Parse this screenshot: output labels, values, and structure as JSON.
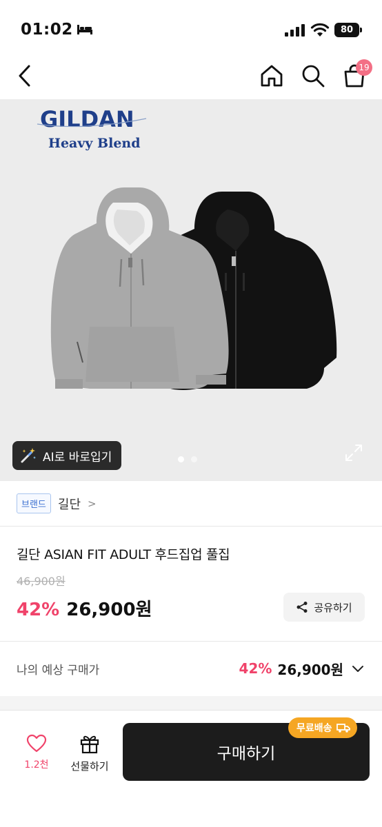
{
  "status_bar": {
    "time": "01:02",
    "battery": "80"
  },
  "nav": {
    "cart_count": "19"
  },
  "hero": {
    "logo_brand": "GILDAN",
    "logo_sub": "Heavy Blend",
    "ai_button_label": "AI로 바로입기",
    "slide_count": 2,
    "active_slide": 1
  },
  "brand": {
    "tag": "브랜드",
    "name": "길단",
    "chevron": ">"
  },
  "product": {
    "title": "길단 ASIAN FIT ADULT 후드집업 풀집",
    "original_price": "46,900원",
    "discount": "42%",
    "price": "26,900원",
    "share_label": "공유하기"
  },
  "expected": {
    "label": "나의 예상 구매가",
    "discount": "42%",
    "price": "26,900원"
  },
  "bottom": {
    "like_count": "1.2천",
    "gift_label": "선물하기",
    "buy_label": "구매하기",
    "free_shipping": "무료배송"
  },
  "colors": {
    "accent_pink": "#f0436a",
    "badge": "#f36f85",
    "free_shipping": "#f5a623",
    "buy_button": "#1c1c1c"
  }
}
